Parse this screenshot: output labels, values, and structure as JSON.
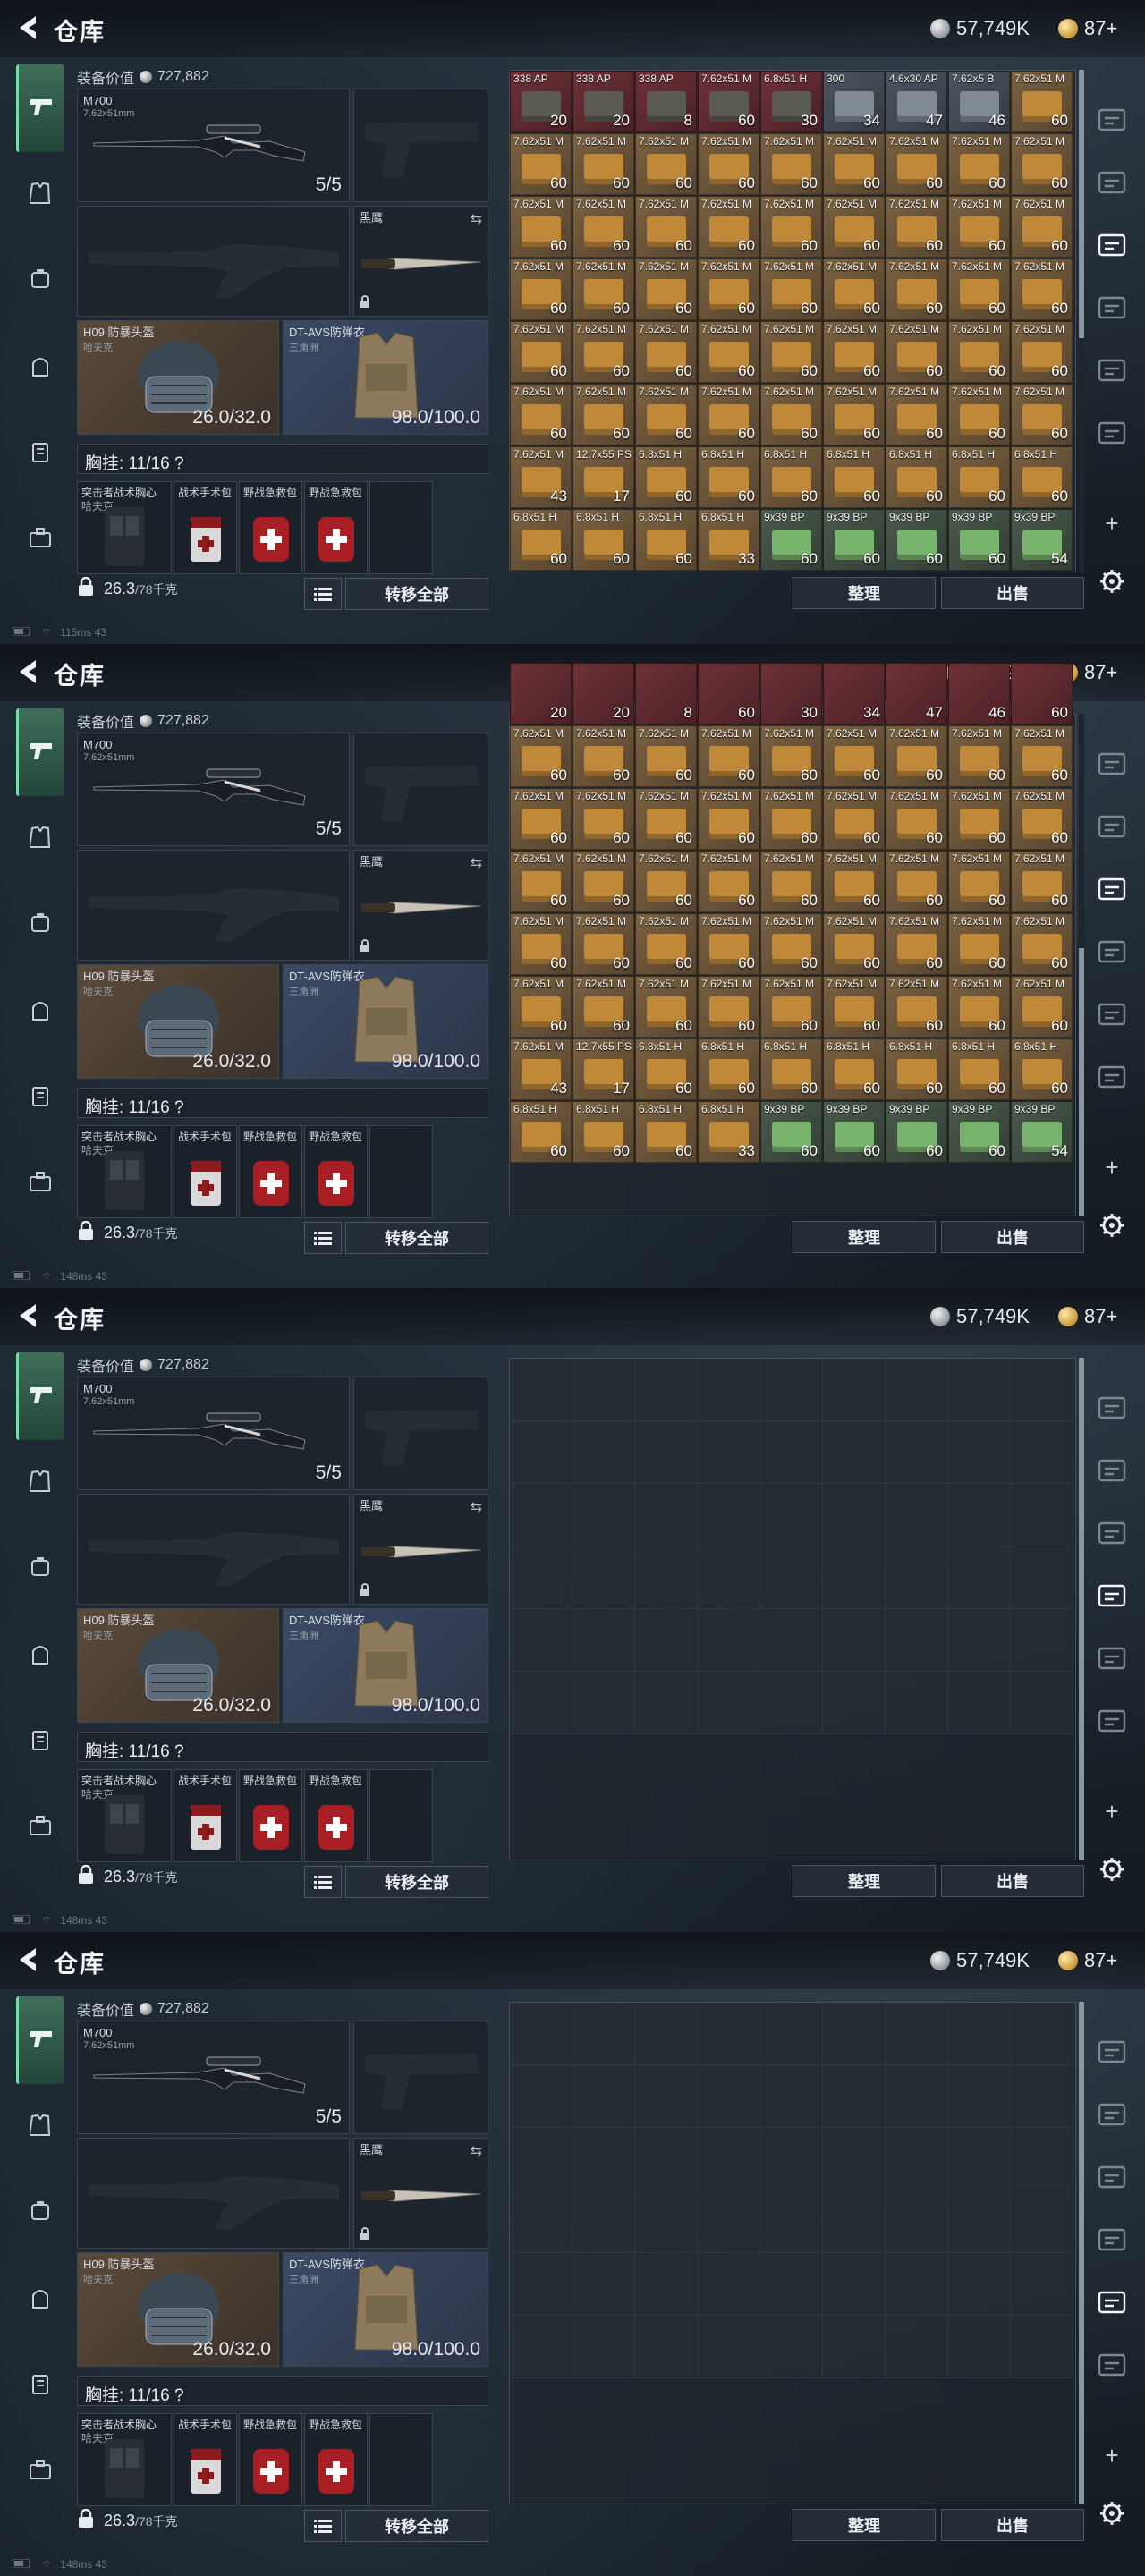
{
  "title": "仓库",
  "currency": {
    "silver": "57,749K",
    "gold": "87+"
  },
  "equipment": {
    "value_label": "装备价值",
    "value": "727,882",
    "primary": {
      "name": "M700",
      "ammo": "7.62x51mm",
      "count": "5/5"
    },
    "melee": {
      "name": "黑鹰"
    },
    "helmet": {
      "name": "H09 防暴头盔",
      "sub": "哈夫克",
      "durability": [
        "26.0/32.0",
        "26.0/32.0",
        "26.0/32.0",
        "26.0/32.0"
      ]
    },
    "armor": {
      "name": "DT-AVS防弹衣",
      "sub": "三角洲",
      "durability": "98.0/100.0"
    },
    "rig": {
      "label": "胸挂: 11/16 ?"
    },
    "rig_items": [
      {
        "name": "突击者战术胸心",
        "sub": "哈夫克"
      },
      {
        "name": "战术手术包"
      },
      {
        "name": "野战急救包"
      },
      {
        "name": "野战急救包"
      }
    ],
    "weight": "26.3",
    "weight_unit": "/78千克",
    "transfer_all": "转移全部"
  },
  "actions": {
    "sort": "整理",
    "sell": "出售"
  },
  "statusbars": [
    "115ms  43",
    "148ms  43",
    "148ms  43",
    "148ms  43"
  ],
  "colors": {
    "accent": "#6fe0a8",
    "ammo_box": "#b8873a",
    "ammo_green": "#5b8a53",
    "ammo_red": "#7a2c31",
    "ammo_gray": "#5d6670"
  },
  "inventory": {
    "frame1": [
      {
        "l": "338\nAP",
        "q": "20",
        "t": "red"
      },
      {
        "l": "338\nAP",
        "q": "20",
        "t": "red"
      },
      {
        "l": "338\nAP",
        "q": "8",
        "t": "red"
      },
      {
        "l": "7.62x51\nM",
        "q": "60",
        "t": "red"
      },
      {
        "l": "6.8x51\nH",
        "q": "30",
        "t": "red"
      },
      {
        "l": "300\n",
        "q": "34",
        "t": "gray"
      },
      {
        "l": "4.6x30\nAP",
        "q": "47",
        "t": "gray"
      },
      {
        "l": "7.62x5\nB",
        "q": "46",
        "t": "gray"
      },
      {
        "l": "7.62x51\nM",
        "q": "60",
        "t": "box"
      },
      {
        "l": "7.62x51\nM",
        "q": "60",
        "t": "box"
      },
      {
        "l": "7.62x51\nM",
        "q": "60",
        "t": "box"
      },
      {
        "l": "7.62x51\nM",
        "q": "60",
        "t": "box"
      },
      {
        "l": "7.62x51\nM",
        "q": "60",
        "t": "box"
      },
      {
        "l": "7.62x51\nM",
        "q": "60",
        "t": "box"
      },
      {
        "l": "7.62x51\nM",
        "q": "60",
        "t": "box"
      },
      {
        "l": "7.62x51\nM",
        "q": "60",
        "t": "box"
      },
      {
        "l": "7.62x51\nM",
        "q": "60",
        "t": "box"
      },
      {
        "l": "7.62x51\nM",
        "q": "60",
        "t": "box"
      },
      {
        "l": "7.62x51\nM",
        "q": "60",
        "t": "box"
      },
      {
        "l": "7.62x51\nM",
        "q": "60",
        "t": "box"
      },
      {
        "l": "7.62x51\nM",
        "q": "60",
        "t": "box"
      },
      {
        "l": "7.62x51\nM",
        "q": "60",
        "t": "box"
      },
      {
        "l": "7.62x51\nM",
        "q": "60",
        "t": "box"
      },
      {
        "l": "7.62x51\nM",
        "q": "60",
        "t": "box"
      },
      {
        "l": "7.62x51\nM",
        "q": "60",
        "t": "box"
      },
      {
        "l": "7.62x51\nM",
        "q": "60",
        "t": "box"
      },
      {
        "l": "7.62x51\nM",
        "q": "60",
        "t": "box"
      },
      {
        "l": "7.62x51\nM",
        "q": "60",
        "t": "box"
      },
      {
        "l": "7.62x51\nM",
        "q": "60",
        "t": "box"
      },
      {
        "l": "7.62x51\nM",
        "q": "60",
        "t": "box"
      },
      {
        "l": "7.62x51\nM",
        "q": "60",
        "t": "box"
      },
      {
        "l": "7.62x51\nM",
        "q": "60",
        "t": "box"
      },
      {
        "l": "7.62x51\nM",
        "q": "60",
        "t": "box"
      },
      {
        "l": "7.62x51\nM",
        "q": "60",
        "t": "box"
      },
      {
        "l": "7.62x51\nM",
        "q": "60",
        "t": "box"
      },
      {
        "l": "7.62x51\nM",
        "q": "60",
        "t": "box"
      },
      {
        "l": "7.62x51\nM",
        "q": "60",
        "t": "box"
      },
      {
        "l": "7.62x51\nM",
        "q": "60",
        "t": "box"
      },
      {
        "l": "7.62x51\nM",
        "q": "60",
        "t": "box"
      },
      {
        "l": "7.62x51\nM",
        "q": "60",
        "t": "box"
      },
      {
        "l": "7.62x51\nM",
        "q": "60",
        "t": "box"
      },
      {
        "l": "7.62x51\nM",
        "q": "60",
        "t": "box"
      },
      {
        "l": "7.62x51\nM",
        "q": "60",
        "t": "box"
      },
      {
        "l": "7.62x51\nM",
        "q": "60",
        "t": "box"
      },
      {
        "l": "7.62x51\nM",
        "q": "60",
        "t": "box"
      },
      {
        "l": "7.62x51\nM",
        "q": "60",
        "t": "box"
      },
      {
        "l": "7.62x51\nM",
        "q": "60",
        "t": "box"
      },
      {
        "l": "7.62x51\nM",
        "q": "60",
        "t": "box"
      },
      {
        "l": "7.62x51\nM",
        "q": "60",
        "t": "box"
      },
      {
        "l": "7.62x51\nM",
        "q": "60",
        "t": "box"
      },
      {
        "l": "7.62x51\nM",
        "q": "60",
        "t": "box"
      },
      {
        "l": "7.62x51\nM",
        "q": "60",
        "t": "box"
      },
      {
        "l": "7.62x51\nM",
        "q": "60",
        "t": "box"
      },
      {
        "l": "7.62x51\nM",
        "q": "60",
        "t": "box"
      },
      {
        "l": "7.62x51\nM",
        "q": "43",
        "t": "box"
      },
      {
        "l": "12.7x55\nPS",
        "q": "17",
        "t": "box"
      },
      {
        "l": "6.8x51\nH",
        "q": "60",
        "t": "box"
      },
      {
        "l": "6.8x51\nH",
        "q": "60",
        "t": "box"
      },
      {
        "l": "6.8x51\nH",
        "q": "60",
        "t": "box"
      },
      {
        "l": "6.8x51\nH",
        "q": "60",
        "t": "box"
      },
      {
        "l": "6.8x51\nH",
        "q": "60",
        "t": "box"
      },
      {
        "l": "6.8x51\nH",
        "q": "60",
        "t": "box"
      },
      {
        "l": "6.8x51\nH",
        "q": "60",
        "t": "box"
      },
      {
        "l": "6.8x51\nH",
        "q": "60",
        "t": "box"
      },
      {
        "l": "6.8x51\nH",
        "q": "60",
        "t": "box"
      },
      {
        "l": "6.8x51\nH",
        "q": "60",
        "t": "box"
      },
      {
        "l": "6.8x51\nH",
        "q": "33",
        "t": "box"
      },
      {
        "l": "9x39\nBP",
        "q": "60",
        "t": "green"
      },
      {
        "l": "9x39\nBP",
        "q": "60",
        "t": "green"
      },
      {
        "l": "9x39\nBP",
        "q": "60",
        "t": "green"
      },
      {
        "l": "9x39\nBP",
        "q": "60",
        "t": "green"
      },
      {
        "l": "9x39\nBP",
        "q": "54",
        "t": "green"
      }
    ],
    "frame2_top": [
      "20",
      "20",
      "8",
      "60",
      "30",
      "34",
      "47",
      "46",
      "60"
    ]
  }
}
